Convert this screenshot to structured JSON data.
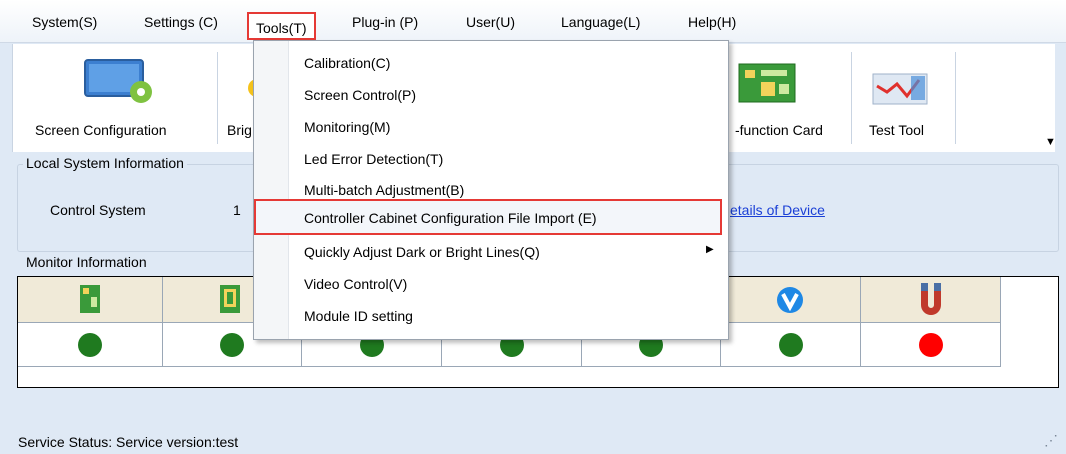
{
  "menubar": {
    "items": [
      "System(S)",
      "Settings (C)",
      "Tools(T)",
      "Plug-in (P)",
      "User(U)",
      "Language(L)",
      "Help(H)"
    ]
  },
  "toolbar": {
    "buttons": [
      {
        "label": "Screen Configuration",
        "icon": "screen-config-icon"
      },
      {
        "label": "Brig",
        "icon": "brightness-icon"
      },
      {
        "label": "-function Card",
        "icon": "multifunction-card-icon"
      },
      {
        "label": "Test Tool",
        "icon": "test-tool-icon"
      }
    ]
  },
  "local_system": {
    "title": "Local System Information",
    "control_label": "Control System",
    "control_value": "1",
    "details_link": "etails of Device"
  },
  "monitor": {
    "title": "Monitor Information",
    "column_icons": [
      "card-icon",
      "receiver-card-icon",
      "",
      "",
      "",
      "v-logo-icon",
      "magnet-icon"
    ],
    "status_colors": [
      "#1f7a1f",
      "#1f7a1f",
      "#1f7a1f",
      "#1f7a1f",
      "#1f7a1f",
      "#1f7a1f",
      "#ff0000"
    ]
  },
  "tools_menu": {
    "items": [
      "Calibration(C)",
      "Screen Control(P)",
      "Monitoring(M)",
      "Led Error Detection(T)",
      "Multi-batch Adjustment(B)",
      "Controller Cabinet Configuration File Import (E)",
      "Quickly Adjust Dark or Bright Lines(Q)",
      "Video Control(V)",
      "Module ID setting"
    ],
    "submenu_arrow": "▶"
  },
  "status_bar": {
    "text": "Service Status:  Service version:test",
    "grip": "⋰"
  }
}
